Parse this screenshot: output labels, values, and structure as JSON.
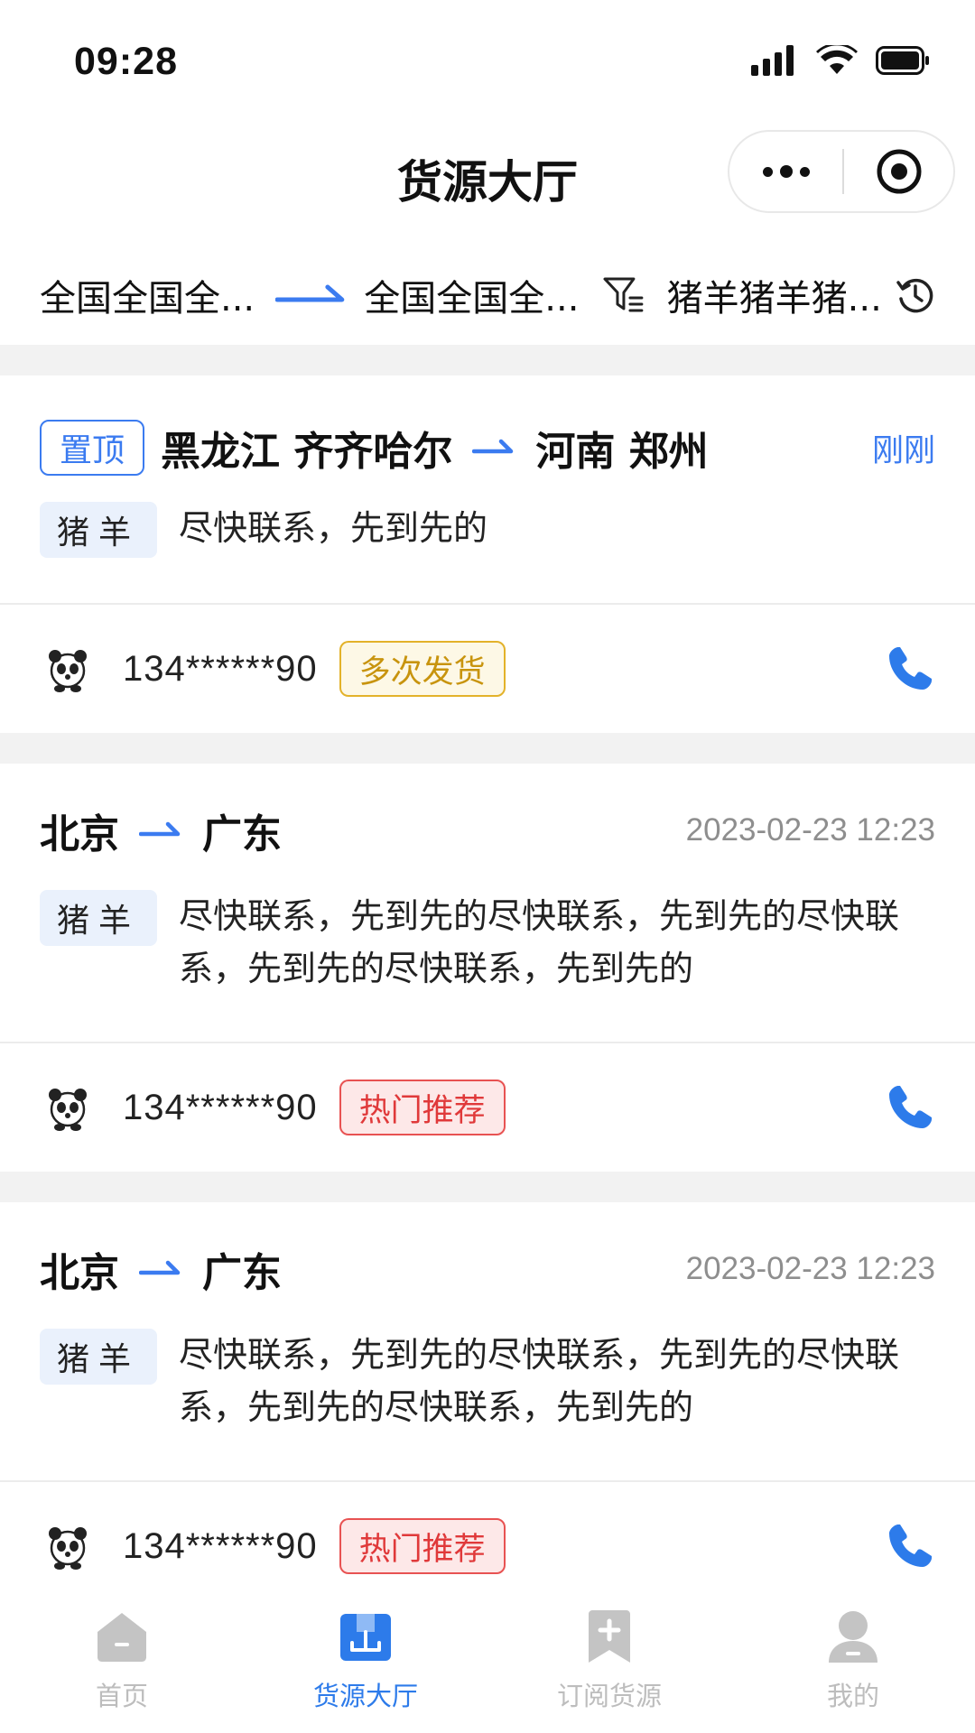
{
  "status_bar": {
    "time": "09:28"
  },
  "nav": {
    "title": "货源大厅"
  },
  "filter": {
    "origin": "全国全国全...",
    "destination": "全国全国全...",
    "cargo": "猪羊猪羊猪..."
  },
  "cards": [
    {
      "pinned_label": "置顶",
      "origin": "黑龙江 齐齐哈尔",
      "destination": "河南 郑州",
      "time": "刚刚",
      "cargo_tag": "猪羊",
      "description": "尽快联系，先到先的",
      "phone": "134******90",
      "badge": "多次发货"
    },
    {
      "origin": "北京",
      "destination": "广东",
      "time": "2023-02-23 12:23",
      "cargo_tag": "猪羊",
      "description": "尽快联系，先到先的尽快联系，先到先的尽快联系，先到先的尽快联系，先到先的",
      "phone": "134******90",
      "badge": "热门推荐"
    },
    {
      "origin": "北京",
      "destination": "广东",
      "time": "2023-02-23 12:23",
      "cargo_tag": "猪羊",
      "description": "尽快联系，先到先的尽快联系，先到先的尽快联系，先到先的尽快联系，先到先的",
      "phone": "134******90",
      "badge": "热门推荐"
    }
  ],
  "tabs": [
    {
      "label": "首页",
      "icon": "home-icon",
      "active": false
    },
    {
      "label": "货源大厅",
      "icon": "cargo-hall-icon",
      "active": true
    },
    {
      "label": "订阅货源",
      "icon": "subscribe-icon",
      "active": false
    },
    {
      "label": "我的",
      "icon": "profile-icon",
      "active": false
    }
  ],
  "colors": {
    "accent": "#3b7bf0",
    "tab_active": "#2d7bea",
    "tab_inactive": "#bdbdbd",
    "badge_yellow": "#c8940e",
    "badge_red": "#e0393a",
    "cargo_tag_bg": "#eaf1fc"
  }
}
